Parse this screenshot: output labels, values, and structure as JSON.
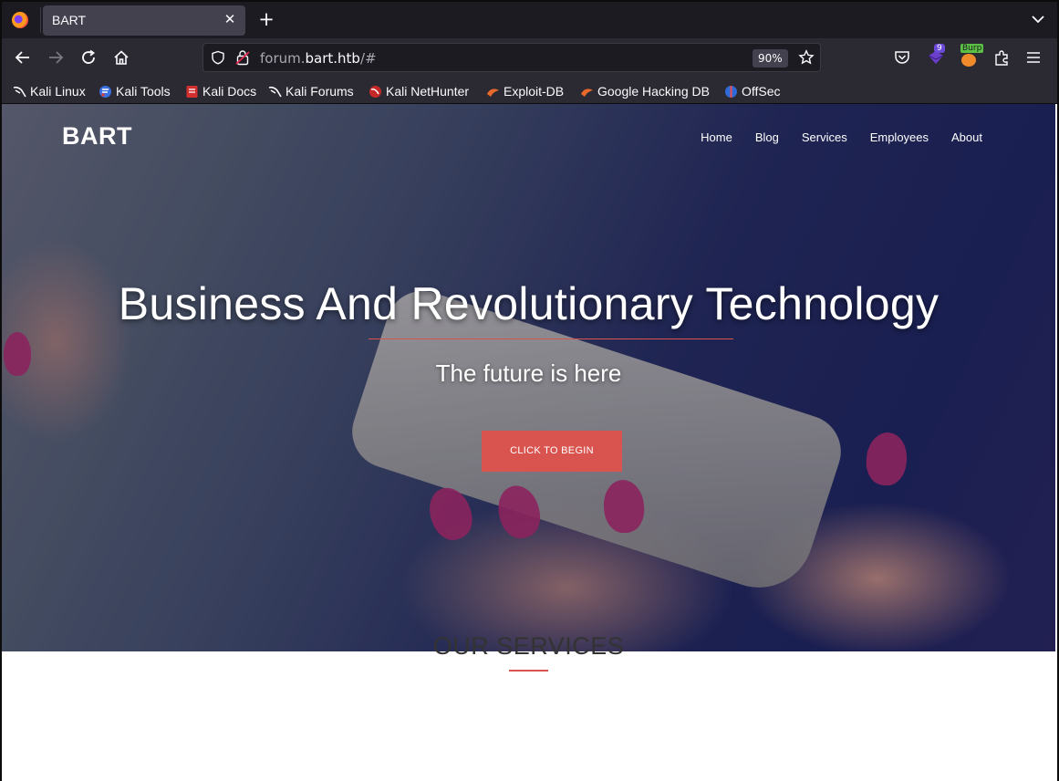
{
  "browser": {
    "tab": {
      "title": "BART"
    },
    "url": {
      "host_prefix": "forum.",
      "host_main": "bart.htb",
      "path": "/#"
    },
    "zoom": "90%",
    "extension_badge": "9",
    "burp_badge": "Burp",
    "bookmarks": [
      {
        "label": "Kali Linux",
        "icon": "kali-dragon-icon"
      },
      {
        "label": "Kali Tools",
        "icon": "kali-tools-icon"
      },
      {
        "label": "Kali Docs",
        "icon": "kali-docs-icon"
      },
      {
        "label": "Kali Forums",
        "icon": "kali-forums-icon"
      },
      {
        "label": "Kali NetHunter",
        "icon": "kali-nethunter-icon"
      },
      {
        "label": "Exploit-DB",
        "icon": "exploit-db-icon"
      },
      {
        "label": "Google Hacking DB",
        "icon": "ghdb-icon"
      },
      {
        "label": "OffSec",
        "icon": "offsec-icon"
      }
    ]
  },
  "site": {
    "brand": "BART",
    "nav": [
      "Home",
      "Blog",
      "Services",
      "Employees",
      "About"
    ],
    "hero_title": "Business And Revolutionary Technology",
    "hero_subtitle": "The future is here",
    "cta": "CLICK TO BEGIN",
    "services_heading": "OUR SERVICES"
  },
  "colors": {
    "accent": "#d9534f",
    "chrome_dark": "#1c1b22",
    "chrome": "#2b2a33"
  }
}
